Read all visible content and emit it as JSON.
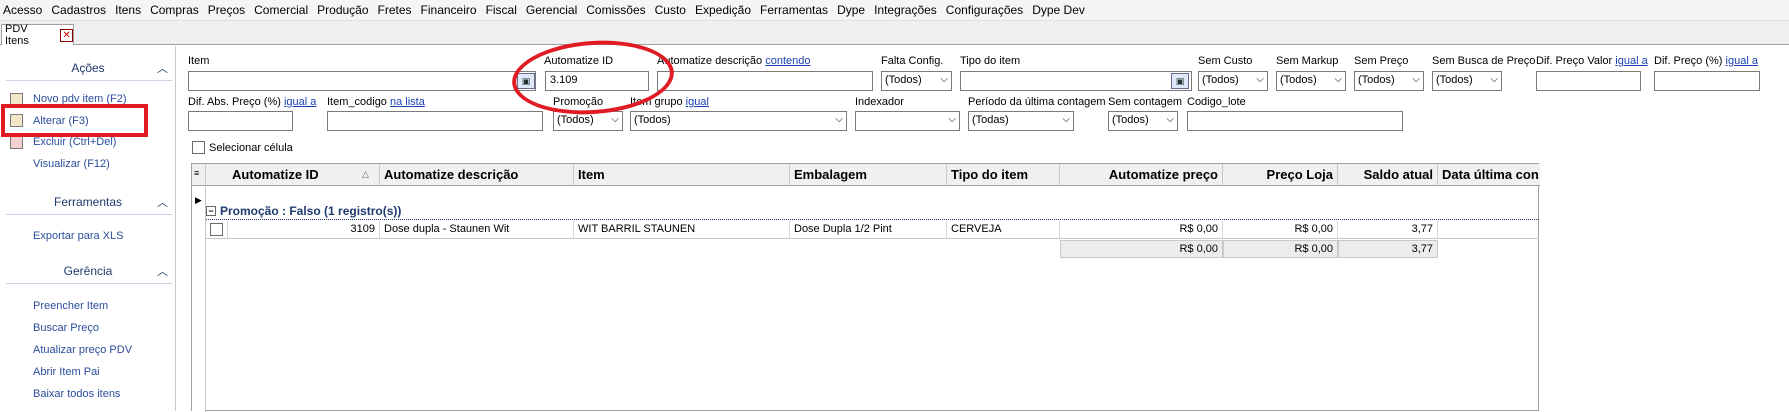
{
  "menu": [
    "Acesso",
    "Cadastros",
    "Itens",
    "Compras",
    "Preços",
    "Comercial",
    "Produção",
    "Fretes",
    "Financeiro",
    "Fiscal",
    "Gerencial",
    "Comissões",
    "Custo",
    "Expedição",
    "Ferramentas",
    "Dype",
    "Integrações",
    "Configurações",
    "Dype Dev"
  ],
  "tab": {
    "label": "PDV Itens",
    "close": "✕"
  },
  "sidebar": {
    "acoes": {
      "title": "Ações",
      "items": [
        "Novo pdv item (F2)",
        "Alterar (F3)",
        "Excluir (Ctrl+Del)",
        "Visualizar (F12)"
      ]
    },
    "ferramentas": {
      "title": "Ferramentas",
      "items": [
        "Exportar para XLS"
      ]
    },
    "gerencia": {
      "title": "Gerência",
      "items": [
        "Preencher Item",
        "Buscar Preço",
        "Atualizar preço PDV",
        "Abrir Item Pai",
        "Baixar todos itens"
      ]
    }
  },
  "filters": {
    "item_label": "Item",
    "automatize_id_label": "Automatize ID",
    "automatize_id_value": "3.109",
    "desc_label": "Automatize descrição",
    "desc_link": "contendo",
    "falta_config_label": "Falta Config.",
    "falta_config_value": "(Todos)",
    "tipo_item_label": "Tipo do item",
    "sem_custo_label": "Sem Custo",
    "sem_custo_value": "(Todos)",
    "sem_markup_label": "Sem Markup",
    "sem_markup_value": "(Todos)",
    "sem_preco_label": "Sem Preço",
    "sem_preco_value": "(Todos)",
    "sem_busca_label": "Sem Busca de Preço",
    "sem_busca_value": "(Todos)",
    "dif_preco_valor_label": "Dif. Preço Valor",
    "dif_preco_valor_link": "igual a",
    "dif_preco_pct_label": "Dif. Preço (%)",
    "dif_preco_pct_link": "igual a",
    "dif_abs_label": "Dif. Abs. Preço (%)",
    "dif_abs_link": "igual a",
    "item_codigo_label": "Item_codigo",
    "item_codigo_link": "na lista",
    "promocao_label": "Promoção",
    "promocao_value": "(Todos)",
    "item_grupo_label": "Item grupo",
    "item_grupo_link": "igual",
    "item_grupo_value": "(Todos)",
    "indexador_label": "Indexador",
    "periodo_label": "Período da última contagem",
    "periodo_value": "(Todas)",
    "sem_contagem_label": "Sem contagem",
    "sem_contagem_value": "(Todos)",
    "codigo_lote_label": "Codigo_lote",
    "selecionar_celula": "Selecionar célula"
  },
  "grid": {
    "columns": [
      "Automatize ID",
      "Automatize descrição",
      "Item",
      "Embalagem",
      "Tipo do item",
      "Automatize preço",
      "Preço Loja",
      "Saldo atual",
      "Data última con"
    ],
    "group": "Promoção : Falso (1 registro(s))",
    "rows": [
      {
        "id": "3109",
        "desc": "Dose dupla - Staunen Wit",
        "item": "WIT BARRIL STAUNEN",
        "embalagem": "Dose Dupla 1/2 Pint",
        "tipo": "CERVEJA",
        "preco": "R$ 0,00",
        "preco_loja": "R$ 0,00",
        "saldo": "3,77"
      }
    ],
    "summary": {
      "preco": "R$ 0,00",
      "preco_loja": "R$ 0,00",
      "saldo": "3,77"
    }
  }
}
